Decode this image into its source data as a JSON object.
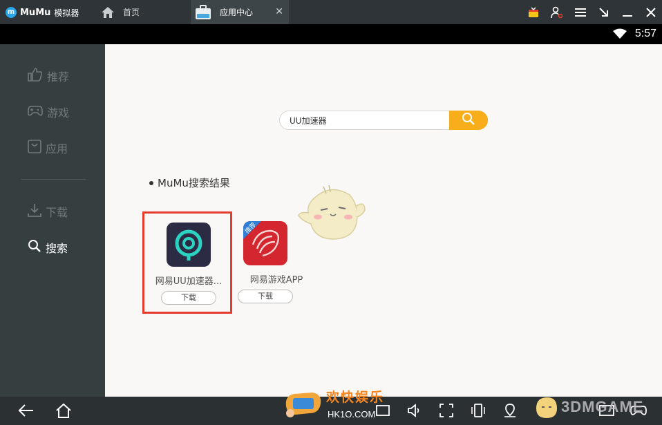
{
  "titlebar": {
    "logo_text": "MuMu",
    "logo_sub": "模拟器",
    "tabs": [
      {
        "label": "首页",
        "icon": "home-icon"
      },
      {
        "label": "应用中心",
        "icon": "app-center-icon",
        "close": "✕"
      }
    ],
    "controls": [
      "gift-icon",
      "user-settings-icon",
      "menu-icon",
      "minimize-arrow-icon",
      "minimize-icon",
      "close-icon"
    ]
  },
  "statusbar": {
    "time": "5:57",
    "wifi": "wifi-icon"
  },
  "sidebar": {
    "items": [
      {
        "label": "推荐",
        "icon": "thumbs-up-icon",
        "active": false
      },
      {
        "label": "游戏",
        "icon": "gamepad-icon",
        "active": false
      },
      {
        "label": "应用",
        "icon": "bag-icon",
        "active": false
      },
      {
        "label": "下载",
        "icon": "download-icon",
        "active": false
      },
      {
        "label": "搜索",
        "icon": "search-icon",
        "active": true
      }
    ]
  },
  "search": {
    "value": "UU加速器",
    "button_icon": "search-icon"
  },
  "results": {
    "title": "MuMu搜索结果",
    "apps": [
      {
        "name": "网易UU加速器...",
        "button": "下载",
        "highlighted": true
      },
      {
        "name": "网易游戏APP",
        "button": "下载",
        "badge": "推荐",
        "highlighted": false
      }
    ]
  },
  "watermark": {
    "text": "欢快娱乐",
    "sub": "HK1O.COM",
    "text2": "3DMGAME"
  },
  "colors": {
    "accent": "#f8ad1b",
    "highlight": "#e53b2c",
    "sidebar_bg": "#353f40",
    "titlebar_bg": "#2e3438"
  }
}
